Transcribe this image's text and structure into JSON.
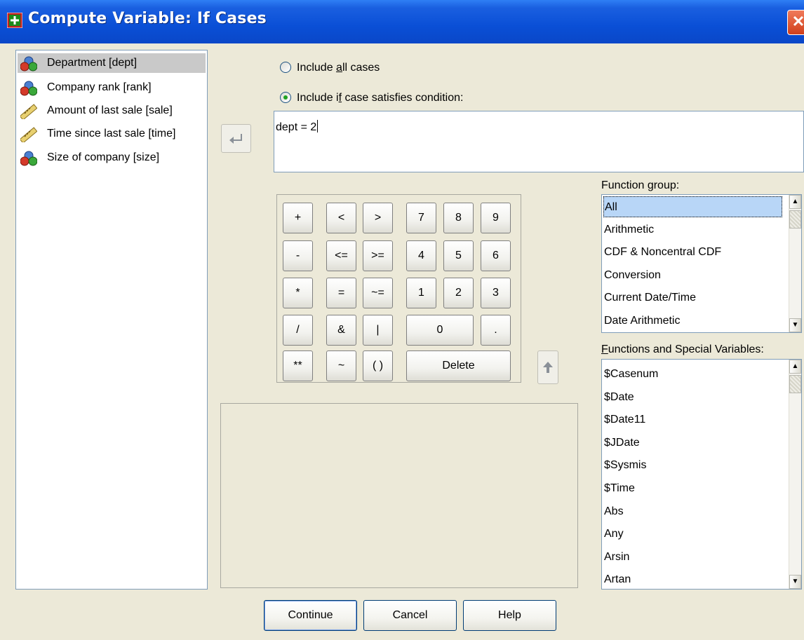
{
  "window": {
    "title": "Compute Variable: If Cases",
    "close_symbol": "✕"
  },
  "variables": [
    {
      "label": "Department [dept]",
      "icon": "nominal-variable-icon",
      "selected": true
    },
    {
      "label": "Company rank [rank]",
      "icon": "nominal-variable-icon",
      "selected": false
    },
    {
      "label": "Amount of last sale [sale]",
      "icon": "scale-variable-icon",
      "selected": false
    },
    {
      "label": "Time since last sale [time]",
      "icon": "scale-variable-icon",
      "selected": false
    },
    {
      "label": "Size of company [size]",
      "icon": "nominal-variable-icon",
      "selected": false
    }
  ],
  "radios": {
    "all_pre": "Include ",
    "all_u": "a",
    "all_post": "ll cases",
    "all_checked": false,
    "cond_pre": "Include i",
    "cond_u": "f",
    "cond_post": " case satisfies condition:",
    "cond_checked": true
  },
  "condition": {
    "value": "dept = 2"
  },
  "keypad": {
    "keys": [
      "+",
      "<",
      ">",
      "7",
      "8",
      "9",
      "-",
      "<=",
      ">=",
      "4",
      "5",
      "6",
      "*",
      "=",
      "~=",
      "1",
      "2",
      "3",
      "/",
      "&",
      "|",
      "0",
      ".",
      "**",
      "~",
      "( )",
      "Delete"
    ]
  },
  "function_group": {
    "label_pre": "Function ",
    "label_u": "g",
    "label_post": "roup:",
    "items": [
      "All",
      "Arithmetic",
      "CDF & Noncentral CDF",
      "Conversion",
      "Current Date/Time",
      "Date Arithmetic"
    ],
    "selected_index": 0
  },
  "functions": {
    "label_u": "F",
    "label_post": "unctions and Special Variables:",
    "items": [
      "$Casenum",
      "$Date",
      "$Date11",
      "$JDate",
      "$Sysmis",
      "$Time",
      "Abs",
      "Any",
      "Arsin",
      "Artan"
    ]
  },
  "buttons": {
    "continue": "Continue",
    "cancel": "Cancel",
    "help": "Help"
  }
}
